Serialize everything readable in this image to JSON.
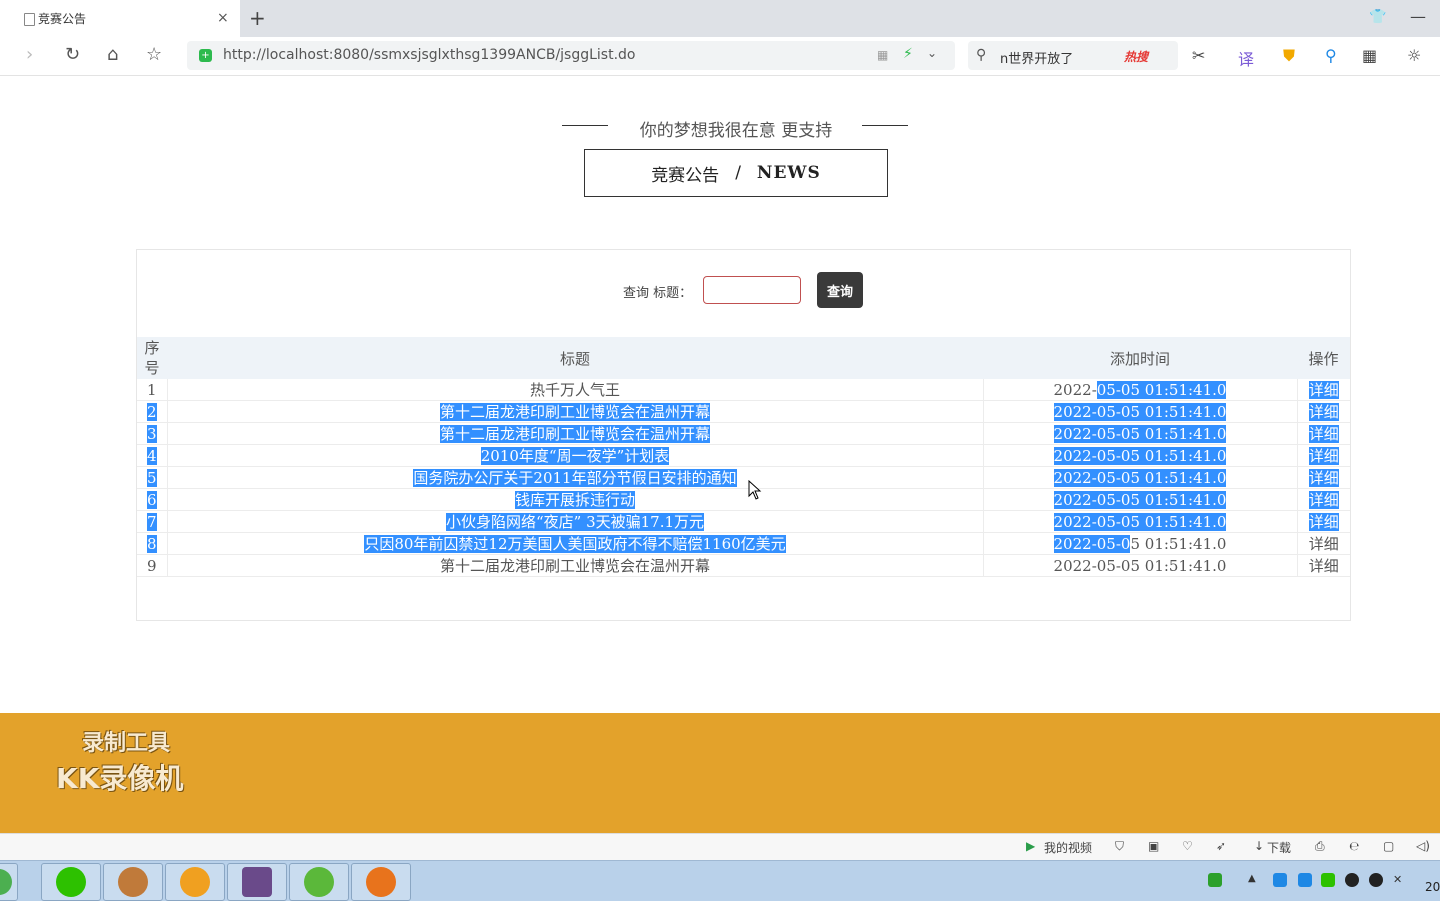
{
  "browser": {
    "tab_title": "竞赛公告",
    "tab_close": "×",
    "new_tab": "+",
    "url": "http://localhost:8080/ssmxsjsglxthsg1399ANCB/jsggList.do",
    "search_text": "n世界开放了",
    "search_hot": "热搜"
  },
  "page": {
    "slogan": "你的梦想我很在意 更支持",
    "heading_cn": "竞赛公告",
    "heading_sep": "/",
    "heading_en": "NEWS",
    "query_label": "查询 标题：",
    "query_value": "",
    "query_button": "查询"
  },
  "table": {
    "headers": {
      "no": "序\n号",
      "title": "标题",
      "time": "添加时间",
      "op": "操作"
    },
    "rows": [
      {
        "no": "1",
        "title": "热千万人气王",
        "time_a": "2022-",
        "time_b": "05-05 01:51:41.0",
        "op": "详细"
      },
      {
        "no": "2",
        "title": "第十二届龙港印刷工业博览会在温州开幕",
        "time": "2022-05-05 01:51:41.0",
        "op": "详细"
      },
      {
        "no": "3",
        "title": "第十二届龙港印刷工业博览会在温州开幕",
        "time": "2022-05-05 01:51:41.0",
        "op": "详细"
      },
      {
        "no": "4",
        "title": "2010年度“周一夜学”计划表",
        "time": "2022-05-05 01:51:41.0",
        "op": "详细"
      },
      {
        "no": "5",
        "title": "国务院办公厅关于2011年部分节假日安排的通知",
        "time": "2022-05-05 01:51:41.0",
        "op": "详细"
      },
      {
        "no": "6",
        "title": "钱库开展拆违行动",
        "time": "2022-05-05 01:51:41.0",
        "op": "详细"
      },
      {
        "no": "7",
        "title": "小伙身陷网络“夜店” 3天被骗17.1万元",
        "time": "2022-05-05 01:51:41.0",
        "op": "详细"
      },
      {
        "no": "8",
        "title": "只因80年前囚禁过12万美国人美国政府不得不赔偿1160亿美元",
        "time_a": "2022-05-0",
        "time_b": "5 01:51:41.0",
        "op": "详细"
      },
      {
        "no": "9",
        "title": "第十二届龙港印刷工业博览会在温州开幕",
        "time": "2022-05-05 01:51:41.0",
        "op": "详细"
      }
    ]
  },
  "watermark": {
    "line1": "录制工具",
    "line2": "KK录像机"
  },
  "statusbar": {
    "my_video": "我的视频",
    "download": "下载"
  },
  "clock_partial": "20"
}
